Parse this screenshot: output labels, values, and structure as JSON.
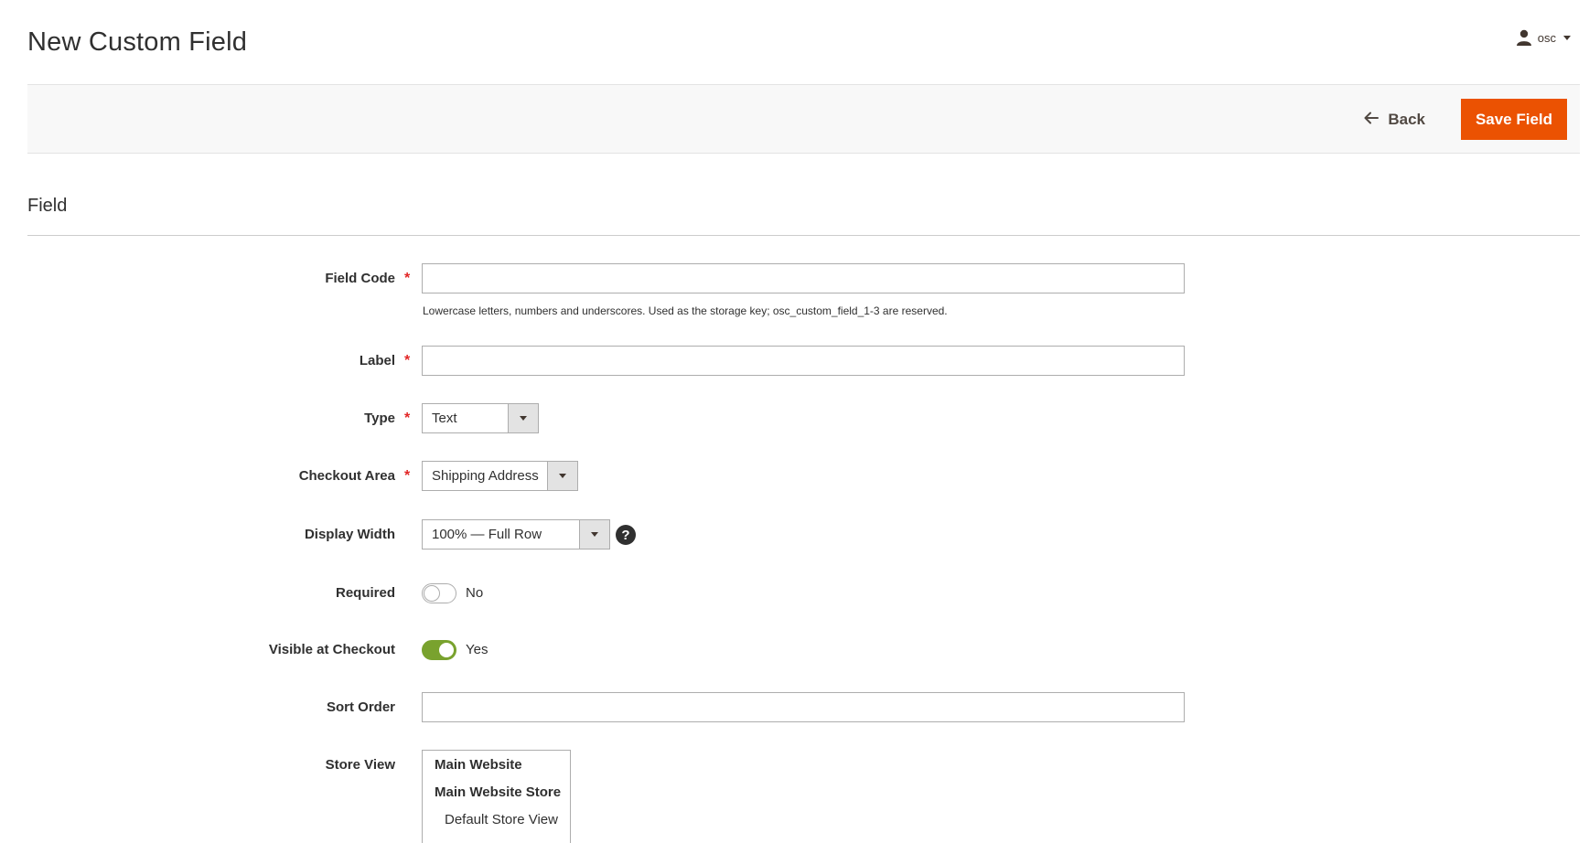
{
  "header": {
    "title": "New Custom Field",
    "user": "osc",
    "user_icon": "user-icon"
  },
  "actions": {
    "back_label": "Back",
    "back_icon": "arrow-left-icon",
    "save_label": "Save Field",
    "save_color": "#eb5202"
  },
  "section": {
    "title": "Field"
  },
  "form": {
    "field_code": {
      "label": "Field Code",
      "required": true,
      "value": "",
      "hint": "Lowercase letters, numbers and underscores. Used as the storage key; osc_custom_field_1-3 are reserved."
    },
    "label": {
      "label": "Label",
      "required": true,
      "value": ""
    },
    "type": {
      "label": "Type",
      "required": true,
      "selected": "Text"
    },
    "checkout_area": {
      "label": "Checkout Area",
      "required": true,
      "selected": "Shipping Address"
    },
    "display_width": {
      "label": "Display Width",
      "selected": "100% — Full Row",
      "help_icon": "question-icon"
    },
    "required": {
      "label": "Required",
      "state": false,
      "state_text": "No"
    },
    "visible": {
      "label": "Visible at Checkout",
      "state": true,
      "state_text": "Yes",
      "on_color": "#79a22e"
    },
    "sort_order": {
      "label": "Sort Order",
      "value": ""
    },
    "store_view": {
      "label": "Store View",
      "options": [
        {
          "text": "Main Website",
          "kind": "group"
        },
        {
          "text": "Main Website Store",
          "kind": "group"
        },
        {
          "text": "Default Store View",
          "kind": "option"
        }
      ]
    }
  },
  "required_marker": "*"
}
